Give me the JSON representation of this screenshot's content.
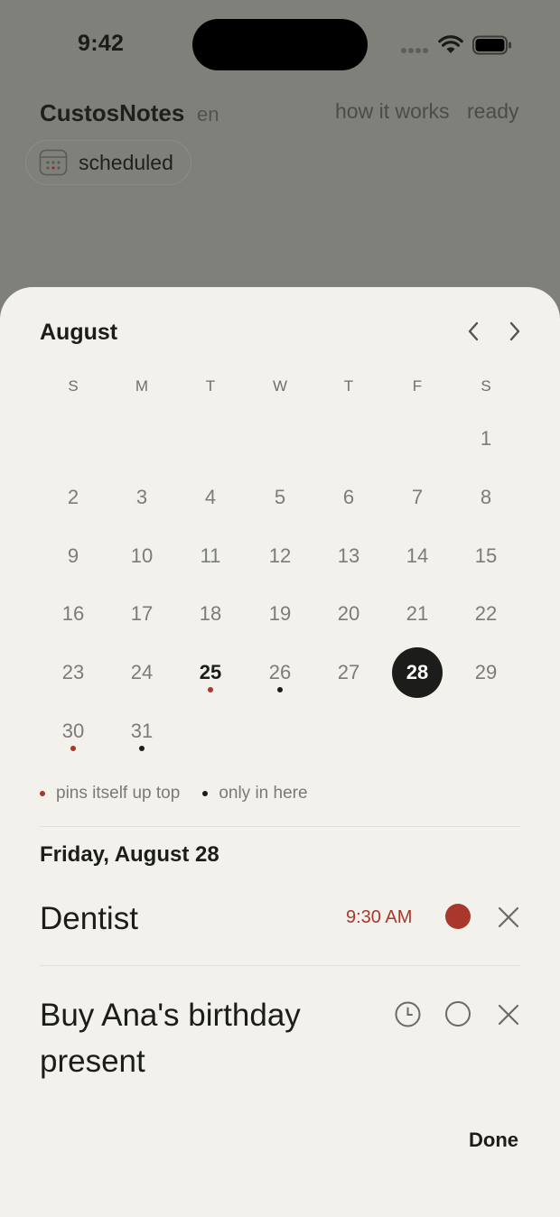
{
  "status_bar": {
    "time": "9:42"
  },
  "app": {
    "title": "CustosNotes",
    "language": "en",
    "nav_how": "how it works",
    "nav_ready": "ready",
    "scheduled_chip": "scheduled"
  },
  "calendar": {
    "month": "August",
    "weekdays": [
      "S",
      "M",
      "T",
      "W",
      "T",
      "F",
      "S"
    ],
    "days": [
      "1",
      "2",
      "3",
      "4",
      "5",
      "6",
      "7",
      "8",
      "9",
      "10",
      "11",
      "12",
      "13",
      "14",
      "15",
      "16",
      "17",
      "18",
      "19",
      "20",
      "21",
      "22",
      "23",
      "24",
      "25",
      "26",
      "27",
      "28",
      "29",
      "30",
      "31"
    ],
    "first_weekday_index": 6,
    "today": "25",
    "selected": "28",
    "markers": {
      "25": "red",
      "26": "black",
      "30": "red",
      "31": "black"
    }
  },
  "legend": {
    "pinned": "pins itself up top",
    "local": "only in here"
  },
  "day_view": {
    "heading": "Friday, August 28",
    "tasks": [
      {
        "title": "Dentist",
        "time": "9:30 AM",
        "pinned": true
      },
      {
        "title": "Buy Ana's birthday present",
        "time": "",
        "pinned": false
      }
    ]
  },
  "done_label": "Done",
  "colors": {
    "accent": "#a8382b",
    "sheet": "#f3f1ec",
    "dim": "#80807b"
  }
}
